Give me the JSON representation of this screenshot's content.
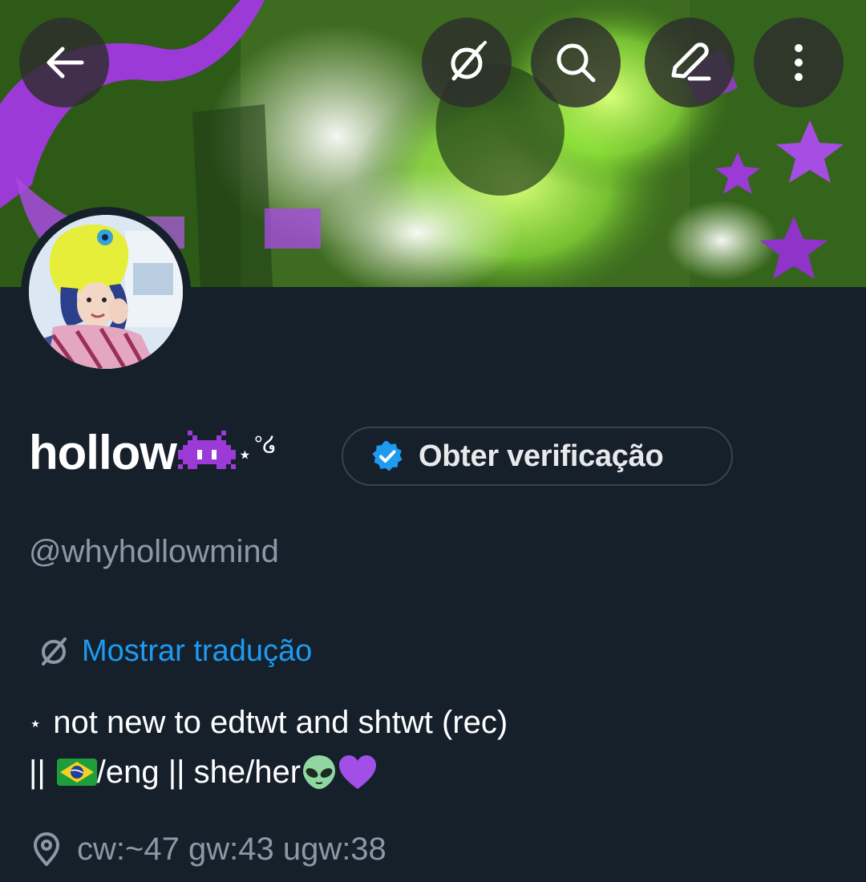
{
  "profile": {
    "display_name": "hollow",
    "name_emoji": "👾",
    "name_deco_star": "⋆",
    "name_deco_swirl": "°໒",
    "verify_button_label": "Obter verificação",
    "handle": "@whyhollowmind",
    "translate_label": "Mostrar tradução",
    "bio_line1_prefix": "⋆",
    "bio_line1": "not new to edtwt and shtwt (rec)",
    "bio_line2_start": "||",
    "bio_flag": "🇧🇷",
    "bio_line2_mid": "/eng || she/her",
    "bio_emoji_alien": "👽",
    "bio_emoji_heart": "💜",
    "location": "cw:~47 gw:43 ugw:38"
  },
  "icons": {
    "back": "arrow-left-icon",
    "translate": "translate-icon",
    "search": "search-icon",
    "edit": "edit-pencil-icon",
    "more": "more-vertical-icon",
    "verified": "verified-badge-icon",
    "location": "location-pin-icon"
  },
  "colors": {
    "background": "#15202b",
    "accent": "#1d9bf0",
    "muted_text": "#8b98a5",
    "border": "#38444d"
  }
}
